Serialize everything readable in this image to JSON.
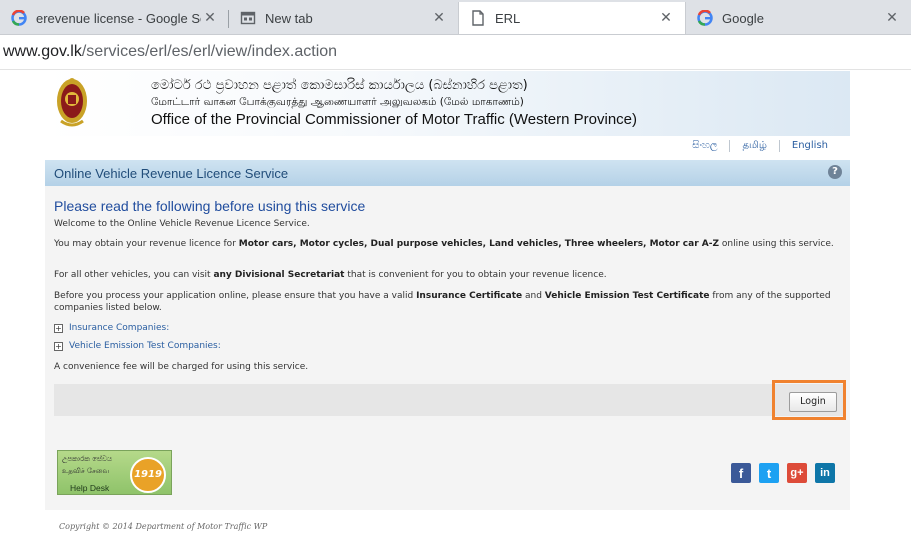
{
  "browser": {
    "tabs": [
      {
        "title": "erevenue license - Google Sear",
        "icon": "google-icon",
        "active": false
      },
      {
        "title": "New tab",
        "icon": "newtab-icon",
        "active": false
      },
      {
        "title": "ERL",
        "icon": "document-icon",
        "active": true
      },
      {
        "title": "Google",
        "icon": "google-icon",
        "active": false
      }
    ],
    "close_glyph": "✕",
    "url_prefix": "www.gov.lk",
    "url_path": "/services/erl/es/erl/view/index.action"
  },
  "header": {
    "line_sinhala": "මෝටර් රථ ප්‍රවාහන පළාත් කොමසාරිස් කාර්යාලය (බස්නාහිර පළාත)",
    "line_tamil": "மோட்டார் வாகன போக்குவரத்து ஆணையாளர் அலுவலகம் (மேல் மாகாணம்)",
    "line_english": "Office of the Provincial Commissioner of Motor Traffic (Western Province)"
  },
  "languages": [
    "සිංහල",
    "தமிழ்",
    "English"
  ],
  "service_title": "Online Vehicle Revenue Licence Service",
  "help_glyph": "?",
  "content": {
    "heading": "Please read the following before using this service",
    "welcome": "Welcome to the Online Vehicle Revenue Licence Service.",
    "p2_a": "You may obtain your revenue licence for ",
    "p2_bold": "Motor cars, Motor cycles, Dual purpose vehicles, Land vehicles, Three wheelers, Motor car A-Z",
    "p2_b": " online using this service.",
    "p3_a": "For all other vehicles, you can visit ",
    "p3_bold": "any Divisional Secretariat",
    "p3_b": " that is convenient for you to obtain your revenue licence.",
    "p4_a": "Before you process your application online, please ensure that you have a valid ",
    "p4_bold1": "Insurance Certificate",
    "p4_and": " and ",
    "p4_bold2": "Vehicle Emission Test Certificate",
    "p4_b": " from any of the supported companies listed below.",
    "expand_glyph": "+",
    "insurance_link": "Insurance Companies:",
    "emission_link": "Vehicle Emission Test Companies:",
    "fee_note": "A convenience fee will be charged for using this service."
  },
  "login_label": "Login",
  "helpdesk": {
    "line1": "උපකාරක සේවය",
    "line2": "உதவிச் சேவை",
    "label": "Help Desk",
    "number": "1919"
  },
  "social": {
    "facebook": "f",
    "twitter": "t",
    "googleplus": "g+",
    "linkedin": "in"
  },
  "footer": {
    "copyright": "Copyright © 2014 Department of Motor Traffic WP"
  }
}
